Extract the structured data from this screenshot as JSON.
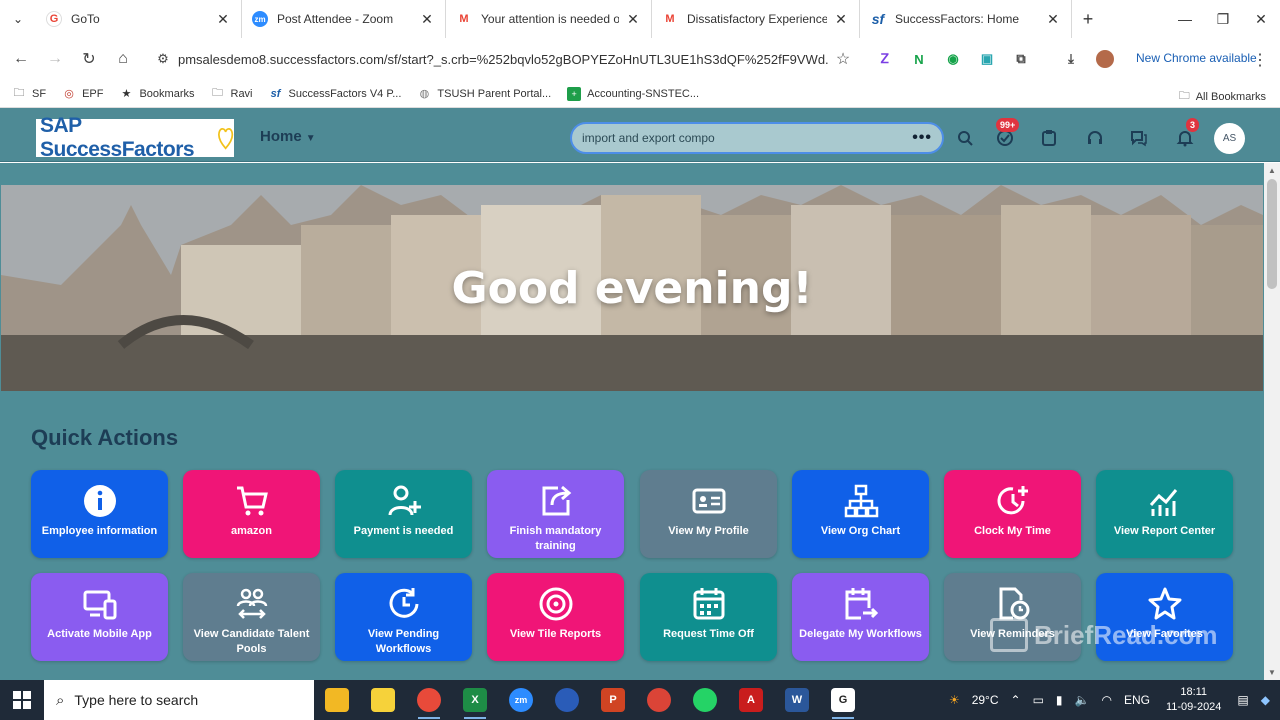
{
  "browser": {
    "tabs": [
      {
        "title": "GoTo",
        "fav": "G",
        "fav_color": "#ea4335"
      },
      {
        "title": "Post Attendee - Zoom",
        "fav": "zm",
        "fav_color": "#2d8cff"
      },
      {
        "title": "Your attention is needed on",
        "fav": "M",
        "fav_color": "#ea4335"
      },
      {
        "title": "Dissatisfactory Experience w",
        "fav": "M",
        "fav_color": "#ea4335"
      },
      {
        "title": "SuccessFactors: Home",
        "fav": "sf",
        "fav_color": "#1b5ea8"
      }
    ],
    "url": "pmsalesdemo8.successfactors.com/sf/start?_s.crb=%252bqvlo52gBOPYEZoHnUTL3UE1hS3dQF%252fF9VWd...",
    "new_chrome": "New Chrome available",
    "bookmarks": [
      {
        "label": "SF",
        "icon": "folder-icon"
      },
      {
        "label": "EPF",
        "icon": "epf-icon"
      },
      {
        "label": "Bookmarks",
        "icon": "star-icon"
      },
      {
        "label": "Ravi",
        "icon": "folder-icon"
      },
      {
        "label": "SuccessFactors V4 P...",
        "icon": "sf-icon"
      },
      {
        "label": "TSUSH Parent Portal...",
        "icon": "globe-icon"
      },
      {
        "label": "Accounting-SNSTEC...",
        "icon": "sheet-icon"
      }
    ],
    "all_bookmarks": "All Bookmarks"
  },
  "sap": {
    "logo": "SAP SuccessFactors",
    "home_menu": "Home",
    "search_value": "import and export compo",
    "todo_badge": "99+",
    "notif_badge": "3",
    "avatar": "AS",
    "greeting": "Good evening!",
    "quick_actions_title": "Quick Actions",
    "tiles": [
      {
        "label": "Employee information",
        "icon": "info-icon",
        "color": "#1060e8"
      },
      {
        "label": "amazon",
        "icon": "cart-icon",
        "color": "#f01577"
      },
      {
        "label": "Payment is needed",
        "icon": "add-person-icon",
        "color": "#0f8f8f"
      },
      {
        "label": "Finish mandatory training",
        "icon": "share-icon",
        "color": "#8a5cf0"
      },
      {
        "label": "View My Profile",
        "icon": "profile-card-icon",
        "color": "#5f7d8f"
      },
      {
        "label": "View Org Chart",
        "icon": "org-chart-icon",
        "color": "#1060e8"
      },
      {
        "label": "Clock My Time",
        "icon": "clock-add-icon",
        "color": "#f01577"
      },
      {
        "label": "View Report Center",
        "icon": "line-chart-icon",
        "color": "#0f8f8f"
      },
      {
        "label": "Activate Mobile App",
        "icon": "devices-icon",
        "color": "#8a5cf0"
      },
      {
        "label": "View Candidate Talent Pools",
        "icon": "people-swap-icon",
        "color": "#5f7d8f"
      },
      {
        "label": "View Pending Workflows",
        "icon": "refresh-clock-icon",
        "color": "#1060e8"
      },
      {
        "label": "View Tile Reports",
        "icon": "target-icon",
        "color": "#f01577"
      },
      {
        "label": "Request Time Off",
        "icon": "calendar-icon",
        "color": "#0f8f8f"
      },
      {
        "label": "Delegate My Workflows",
        "icon": "calendar-forward-icon",
        "color": "#8a5cf0"
      },
      {
        "label": "View Reminders",
        "icon": "doc-clock-icon",
        "color": "#5f7d8f"
      },
      {
        "label": "View Favorites",
        "icon": "star-outline-icon",
        "color": "#1060e8"
      }
    ]
  },
  "watermark": "BriefRead.com",
  "taskbar": {
    "search_placeholder": "Type here to search",
    "temperature": "29°C",
    "language": "ENG",
    "time": "18:11",
    "date": "11-09-2024"
  }
}
